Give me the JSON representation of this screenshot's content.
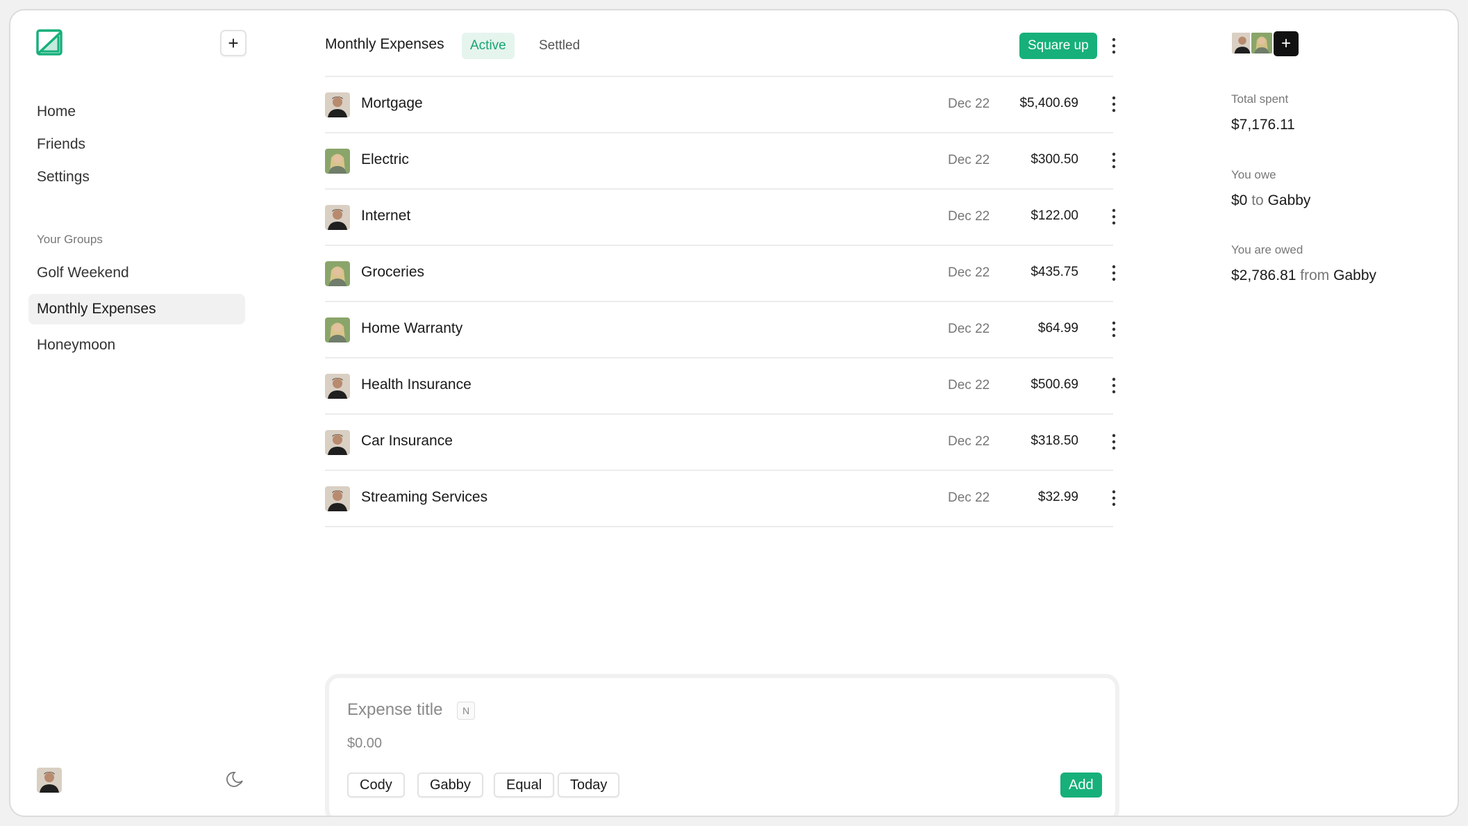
{
  "sidebar": {
    "nav": [
      {
        "label": "Home"
      },
      {
        "label": "Friends"
      },
      {
        "label": "Settings"
      }
    ],
    "groups_label": "Your Groups",
    "groups": [
      {
        "label": "Golf Weekend",
        "active": false
      },
      {
        "label": "Monthly Expenses",
        "active": true
      },
      {
        "label": "Honeymoon",
        "active": false
      }
    ]
  },
  "header": {
    "title": "Monthly Expenses",
    "tab_active": "Active",
    "tab_inactive": "Settled",
    "square_up_label": "Square up"
  },
  "expenses": [
    {
      "title": "Mortgage",
      "date": "Dec 22",
      "amount": "$5,400.69",
      "payer": "Cody"
    },
    {
      "title": "Electric",
      "date": "Dec 22",
      "amount": "$300.50",
      "payer": "Gabby"
    },
    {
      "title": "Internet",
      "date": "Dec 22",
      "amount": "$122.00",
      "payer": "Cody"
    },
    {
      "title": "Groceries",
      "date": "Dec 22",
      "amount": "$435.75",
      "payer": "Gabby"
    },
    {
      "title": "Home Warranty",
      "date": "Dec 22",
      "amount": "$64.99",
      "payer": "Gabby"
    },
    {
      "title": "Health Insurance",
      "date": "Dec 22",
      "amount": "$500.69",
      "payer": "Cody"
    },
    {
      "title": "Car Insurance",
      "date": "Dec 22",
      "amount": "$318.50",
      "payer": "Cody"
    },
    {
      "title": "Streaming Services",
      "date": "Dec 22",
      "amount": "$32.99",
      "payer": "Cody"
    }
  ],
  "composer": {
    "title_placeholder": "Expense title",
    "shortcut_key": "N",
    "amount_placeholder": "$0.00",
    "chips": [
      "Cody",
      "Gabby",
      "Equal",
      "Today"
    ],
    "add_label": "Add"
  },
  "summary": {
    "total_spent_label": "Total spent",
    "total_spent_value": "$7,176.11",
    "you_owe_label": "You owe",
    "you_owe_amount": "$0",
    "you_owe_connector": "to",
    "you_owe_person": "Gabby",
    "owed_label": "You are owed",
    "owed_amount": "$2,786.81",
    "owed_connector": "from",
    "owed_person": "Gabby"
  },
  "colors": {
    "accent": "#17b07a",
    "accent_soft": "#e6f4ee",
    "accent_text": "#16a56f"
  },
  "icons": {
    "logo": "logo-icon",
    "new": "plus-icon",
    "more": "more-vertical-icon",
    "theme": "moon-icon",
    "add_member": "plus-icon"
  }
}
